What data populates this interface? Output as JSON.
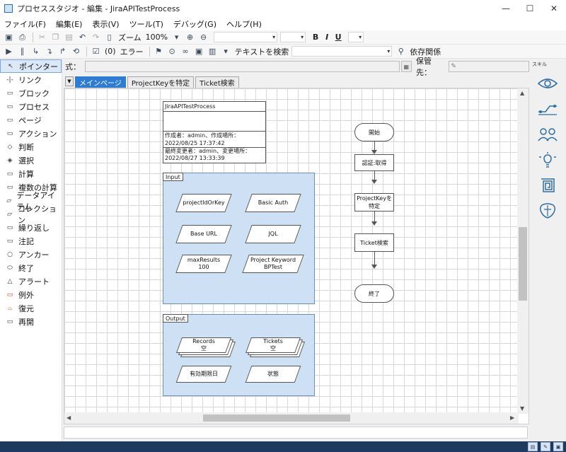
{
  "window": {
    "title": "プロセススタジオ - 編集 - JiraAPITestProcess",
    "minimize": "—",
    "maximize": "☐",
    "close": "✕"
  },
  "menu": [
    "ファイル(F)",
    "編集(E)",
    "表示(V)",
    "ツール(T)",
    "デバッグ(G)",
    "ヘルプ(H)"
  ],
  "toolbar1": {
    "zoom_label": "ズーム",
    "zoom_value": "100%",
    "bold": "B",
    "italic": "I",
    "underline": "U"
  },
  "toolbar2": {
    "step_count": "(0)",
    "error_label": "エラー",
    "search_label": "テキストを検索",
    "dependency_label": "依存関係"
  },
  "tools": [
    {
      "label": "ポインター",
      "icon": "↖"
    },
    {
      "label": "リンク",
      "icon": "-|-"
    },
    {
      "label": "ブロック",
      "icon": "▭"
    },
    {
      "label": "プロセス",
      "icon": "▭"
    },
    {
      "label": "ページ",
      "icon": "▭"
    },
    {
      "label": "アクション",
      "icon": "▭"
    },
    {
      "label": "判断",
      "icon": "◇"
    },
    {
      "label": "選択",
      "icon": "◈"
    },
    {
      "label": "計算",
      "icon": "▭"
    },
    {
      "label": "複数の計算",
      "icon": "▭"
    },
    {
      "label": "データアイテム",
      "icon": "▱"
    },
    {
      "label": "コレクション",
      "icon": "▱"
    },
    {
      "label": "繰り返し",
      "icon": "▭"
    },
    {
      "label": "注記",
      "icon": "▭"
    },
    {
      "label": "アンカー",
      "icon": "○"
    },
    {
      "label": "終了",
      "icon": "⬭"
    },
    {
      "label": "アラート",
      "icon": "△"
    },
    {
      "label": "例外",
      "icon": "▭"
    },
    {
      "label": "復元",
      "icon": "⌓"
    },
    {
      "label": "再開",
      "icon": "▭"
    }
  ],
  "expression": {
    "label": "式：",
    "store_label": "保管先："
  },
  "tabs": [
    {
      "label": "メインページ",
      "active": true
    },
    {
      "label": "ProjectKeyを特定",
      "active": false
    },
    {
      "label": "Ticket検索",
      "active": false
    }
  ],
  "info": {
    "name": "JiraAPITestProcess",
    "created": "作成者：admin、作成場所：",
    "created_date": "2022/08/25 17:37:42",
    "modified": "最終変更者：admin、変更場所：",
    "modified_date": "2022/08/27 13:33:39"
  },
  "input_block": {
    "label": "Input",
    "items": [
      {
        "line1": "projectIdOrKey",
        "line2": ""
      },
      {
        "line1": "Basic Auth",
        "line2": ""
      },
      {
        "line1": "Base URL",
        "line2": ""
      },
      {
        "line1": "JQL",
        "line2": ""
      },
      {
        "line1": "maxResults",
        "line2": "100"
      },
      {
        "line1": "Project Keyword",
        "line2": "BPTest"
      }
    ]
  },
  "output_block": {
    "label": "Output",
    "collections": [
      {
        "line1": "Records",
        "line2": "空"
      },
      {
        "line1": "Tickets",
        "line2": "空"
      }
    ],
    "items": [
      {
        "line1": "有効期限日"
      },
      {
        "line1": "状態"
      }
    ]
  },
  "flow": {
    "start": "開始",
    "step1": "認証:取得",
    "step2": "ProjectKeyを特定",
    "step3": "Ticket検索",
    "end": "終了"
  },
  "skills": {
    "title": "スキル"
  }
}
